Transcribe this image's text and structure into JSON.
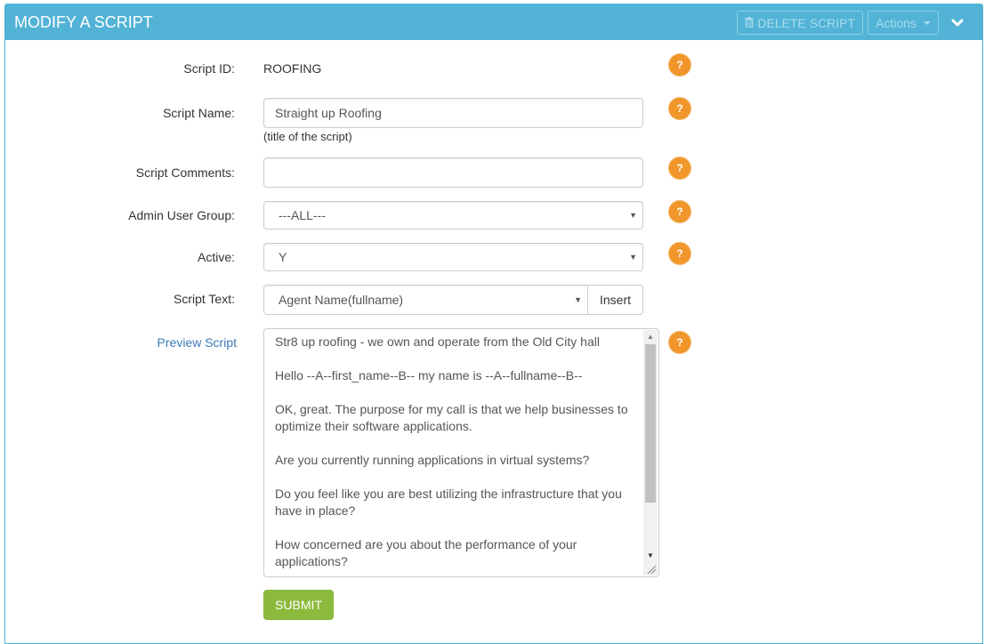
{
  "panel": {
    "title": "MODIFY A SCRIPT",
    "delete_label": "DELETE SCRIPT",
    "actions_label": "Actions",
    "colors": {
      "header": "#52b3d6",
      "help": "#f0962a",
      "submit": "#8cba3c",
      "link": "#3c7ab6"
    }
  },
  "form": {
    "script_id": {
      "label": "Script ID:",
      "value": "ROOFING"
    },
    "script_name": {
      "label": "Script Name:",
      "value": "Straight up Roofing",
      "help": "(title of the script)"
    },
    "script_comments": {
      "label": "Script Comments:",
      "value": ""
    },
    "admin_user_group": {
      "label": "Admin User Group:",
      "selected": "---ALL---"
    },
    "active": {
      "label": "Active:",
      "selected": "Y"
    },
    "script_text": {
      "label": "Script Text:",
      "selected": "Agent Name(fullname)",
      "insert_label": "Insert"
    },
    "preview": {
      "label": "Preview Script",
      "paragraphs": [
        "Str8 up roofing - we own and operate from the Old City hall",
        "Hello --A--first_name--B-- my name is --A--fullname--B--",
        "OK, great. The purpose for my call is that we help businesses to optimize their software applications.",
        "Are you currently running applications in virtual systems?",
        "Do you feel like you are best utilizing the infrastructure that you have in place?",
        "How concerned are you about the performance of your applications?"
      ]
    },
    "help_glyph": "?",
    "submit_label": "SUBMIT"
  }
}
